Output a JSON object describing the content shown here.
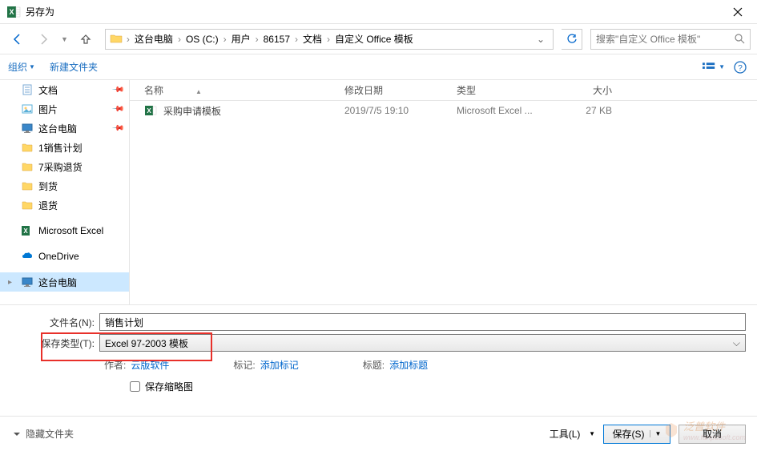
{
  "title": "另存为",
  "breadcrumbs": [
    "这台电脑",
    "OS (C:)",
    "用户",
    "86157",
    "文档",
    "自定义 Office 模板"
  ],
  "search_placeholder": "搜索\"自定义 Office 模板\"",
  "toolbar": {
    "organize": "组织",
    "new_folder": "新建文件夹"
  },
  "columns": {
    "name": "名称",
    "date": "修改日期",
    "type": "类型",
    "size": "大小"
  },
  "sidebar": [
    {
      "label": "文档",
      "icon": "doc",
      "pin": true
    },
    {
      "label": "图片",
      "icon": "pic",
      "pin": true
    },
    {
      "label": "这台电脑",
      "icon": "pc",
      "pin": true
    },
    {
      "label": "1销售计划",
      "icon": "folder"
    },
    {
      "label": "7采购退货",
      "icon": "folder"
    },
    {
      "label": "到货",
      "icon": "folder"
    },
    {
      "label": "退货",
      "icon": "folder"
    },
    {
      "label": "Microsoft Excel",
      "icon": "excel",
      "spacer": true
    },
    {
      "label": "OneDrive",
      "icon": "onedrive",
      "spacer": true
    },
    {
      "label": "这台电脑",
      "icon": "pc",
      "chev": true,
      "selected": true,
      "spacer": true
    }
  ],
  "files": [
    {
      "name": "采购申请模板",
      "date": "2019/7/5 19:10",
      "type": "Microsoft Excel ...",
      "size": "27 KB"
    }
  ],
  "form": {
    "filename_label": "文件名(N):",
    "filename_value": "销售计划",
    "savetype_label": "保存类型(T):",
    "savetype_value": "Excel 97-2003 模板"
  },
  "meta": {
    "author_label": "作者:",
    "author_value": "云版软件",
    "tags_label": "标记:",
    "tags_value": "添加标记",
    "title_label": "标题:",
    "title_value": "添加标题"
  },
  "thumbnail_label": "保存缩略图",
  "footer": {
    "hide_folders": "隐藏文件夹",
    "tools": "工具(L)",
    "save": "保存(S)",
    "cancel": "取消"
  },
  "watermark": {
    "brand": "泛普软件",
    "url": "www.fanpusoft.com"
  }
}
